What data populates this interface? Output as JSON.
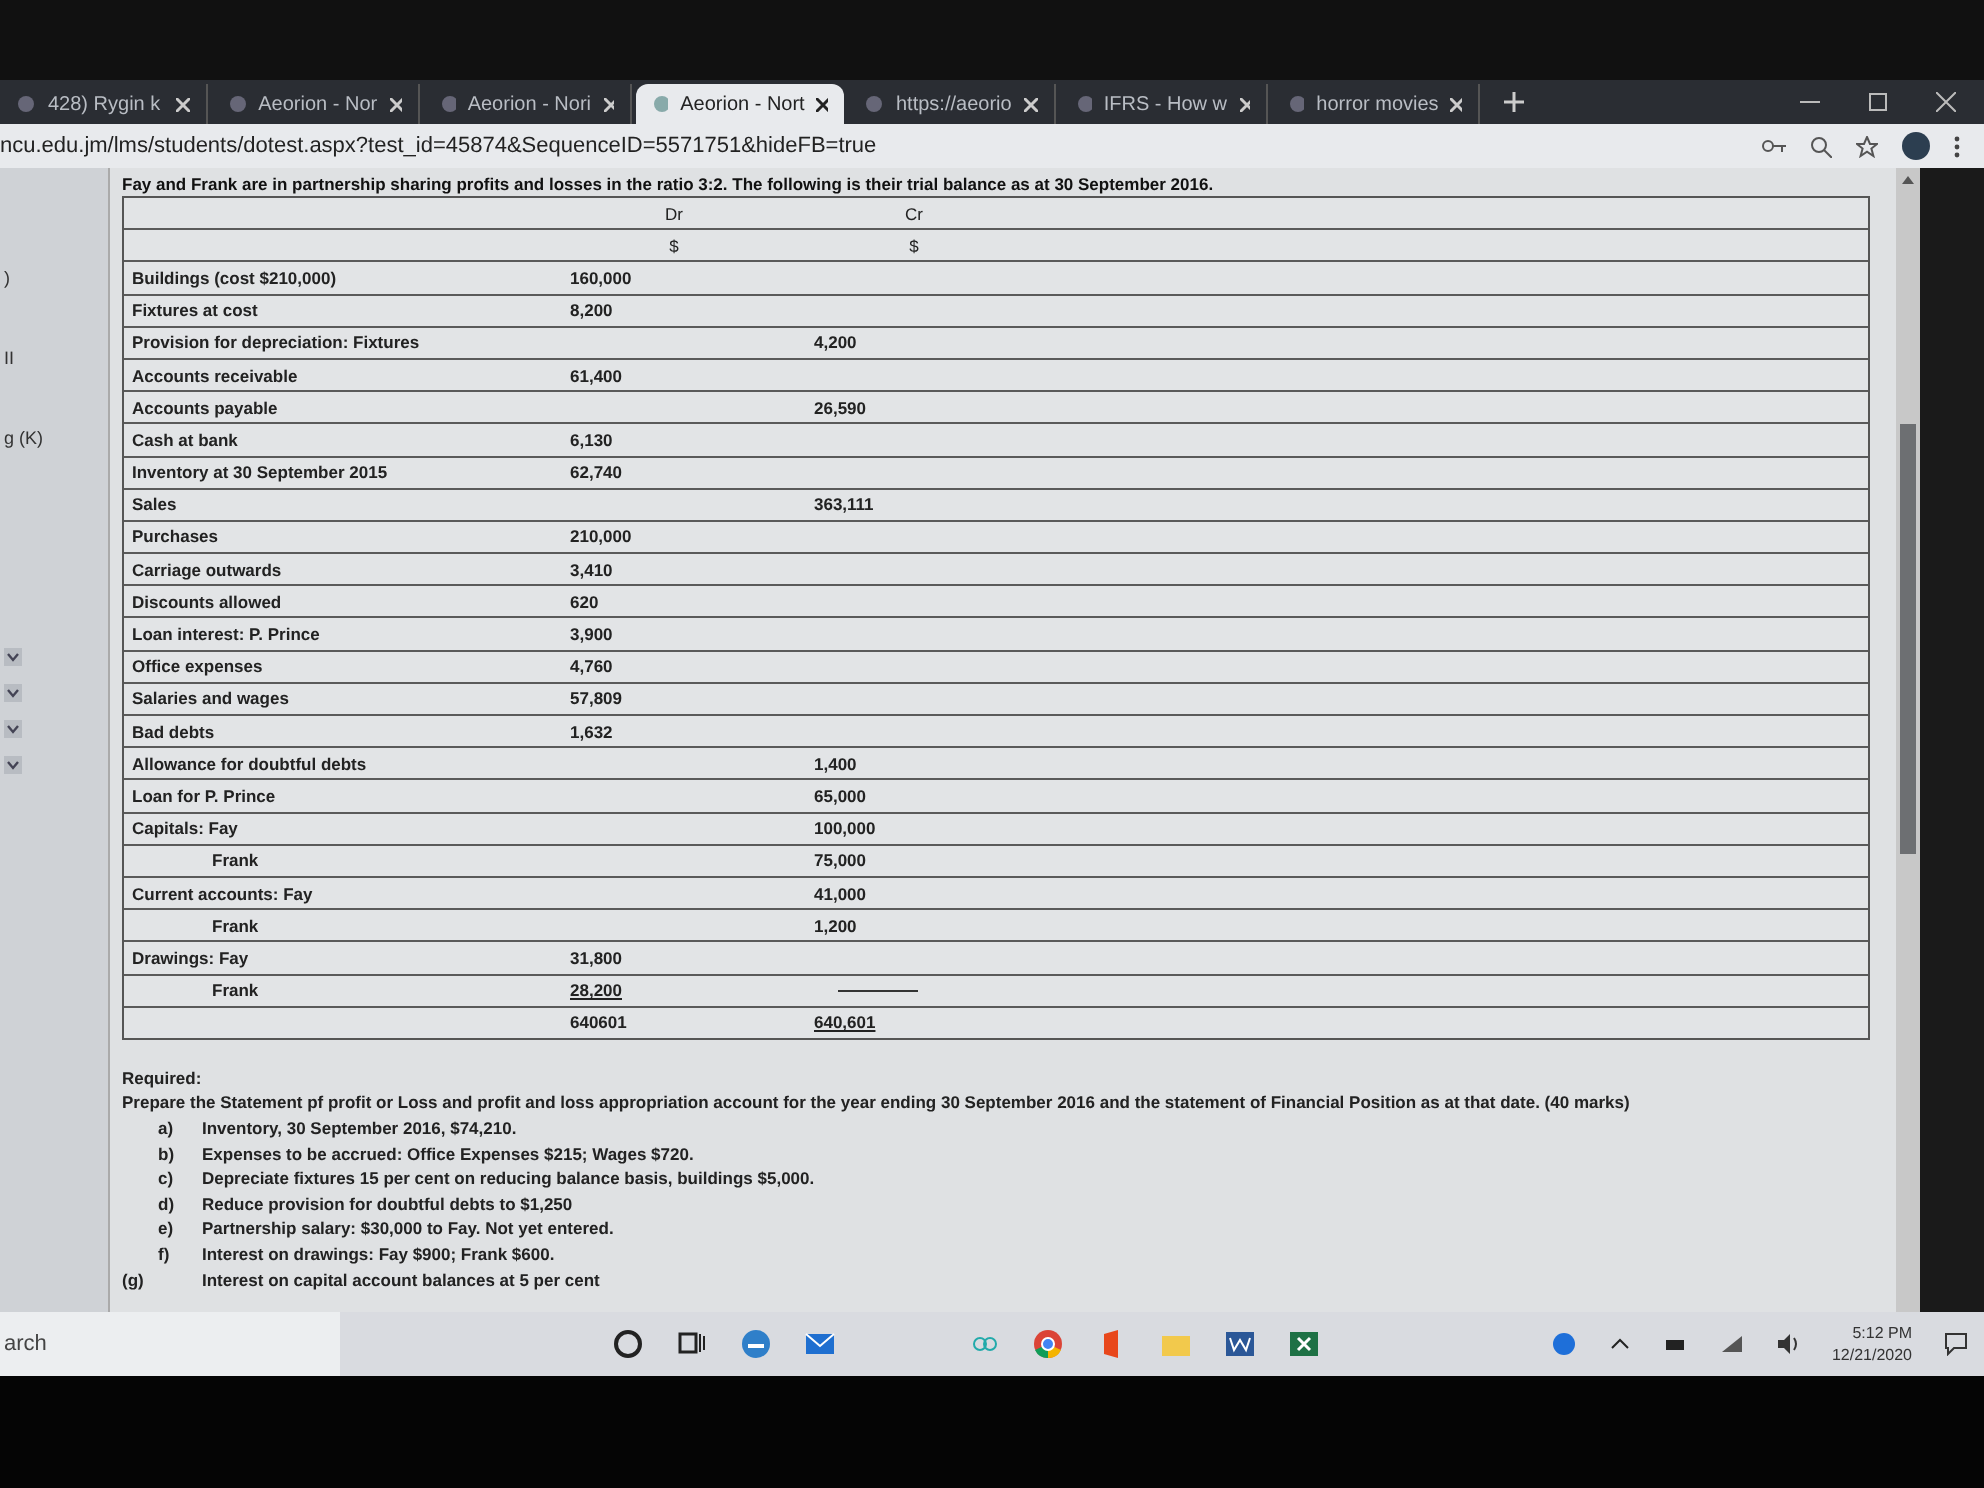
{
  "browser": {
    "tabs": [
      {
        "title": "428) Rygin k",
        "selected": false
      },
      {
        "title": "Aeorion - Nor",
        "selected": false
      },
      {
        "title": "Aeorion - Nori",
        "selected": false
      },
      {
        "title": "Aeorion - Nort",
        "selected": true
      },
      {
        "title": "https://aeorio",
        "selected": false
      },
      {
        "title": "IFRS - How w",
        "selected": false
      },
      {
        "title": "horror movies",
        "selected": false
      }
    ],
    "address": "ncu.edu.jm/lms/students/dotest.aspx?test_id=45874&SequenceID=5571751&hideFB=true"
  },
  "sidebar": {
    "labels": [
      ")",
      "II",
      "g (K)"
    ]
  },
  "question": {
    "intro": "Fay and Frank are in partnership sharing profits and losses in the ratio 3:2. The following is their trial balance as at 30 September 2016.",
    "columns": [
      "Dr",
      "Cr"
    ],
    "units": [
      "$",
      "$"
    ],
    "rows": [
      {
        "label": "Buildings (cost $210,000)",
        "dr": "160,000"
      },
      {
        "label": "Fixtures at cost",
        "dr": "8,200"
      },
      {
        "label": "Provision for depreciation: Fixtures",
        "cr": "4,200"
      },
      {
        "label": "Accounts receivable",
        "dr": "61,400"
      },
      {
        "label": "Accounts payable",
        "cr": "26,590"
      },
      {
        "label": "Cash at bank",
        "dr": "6,130"
      },
      {
        "label": "Inventory at 30 September 2015",
        "dr": "62,740"
      },
      {
        "label": "Sales",
        "cr": "363,111"
      },
      {
        "label": "Purchases",
        "dr": "210,000"
      },
      {
        "label": "Carriage outwards",
        "dr": "3,410"
      },
      {
        "label": "Discounts allowed",
        "dr": "620"
      },
      {
        "label": "Loan interest: P. Prince",
        "dr": "3,900"
      },
      {
        "label": "Office expenses",
        "dr": "4,760"
      },
      {
        "label": "Salaries and wages",
        "dr": "57,809"
      },
      {
        "label": "Bad debts",
        "dr": "1,632"
      },
      {
        "label": "Allowance for doubtful debts",
        "cr": "1,400"
      },
      {
        "label": "Loan for P. Prince",
        "cr": "65,000"
      },
      {
        "label": "Capitals: Fay",
        "cr": "100,000",
        "children": [
          {
            "label": "Frank",
            "cr": "75,000"
          }
        ]
      },
      {
        "label": "Current accounts: Fay",
        "cr": "41,000",
        "children": [
          {
            "label": "Frank",
            "cr": "1,200"
          }
        ]
      },
      {
        "label": "Drawings: Fay",
        "dr": "31,800",
        "children": [
          {
            "label": "Frank",
            "dr": "28,200",
            "underlined": true
          }
        ]
      }
    ],
    "totals": {
      "dr": "640601",
      "cr": "640,601"
    },
    "required_heading": "Required:",
    "instruction": "Prepare the Statement pf profit or Loss and profit and loss appropriation account for the year ending 30 September 2016 and the statement of Financial Position as at that date. (40 marks)",
    "items": [
      {
        "marker": "a)",
        "text": "Inventory, 30 September 2016, $74,210."
      },
      {
        "marker": "b)",
        "text": "Expenses to be accrued: Office Expenses $215; Wages $720."
      },
      {
        "marker": "c)",
        "text": "Depreciate fixtures 15 per cent on reducing balance basis, buildings $5,000."
      },
      {
        "marker": "d)",
        "text": "Reduce provision for doubtful debts to $1,250"
      },
      {
        "marker": "e)",
        "text": "Partnership salary: $30,000 to Fay. Not yet entered."
      },
      {
        "marker": "f)",
        "text": "Interest on drawings: Fay $900; Frank $600."
      },
      {
        "marker": "(g)",
        "text": "Interest on capital account balances at 5 per cent"
      }
    ]
  },
  "taskbar": {
    "search": "arch",
    "time": "5:12 PM",
    "date": "12/21/2020"
  }
}
